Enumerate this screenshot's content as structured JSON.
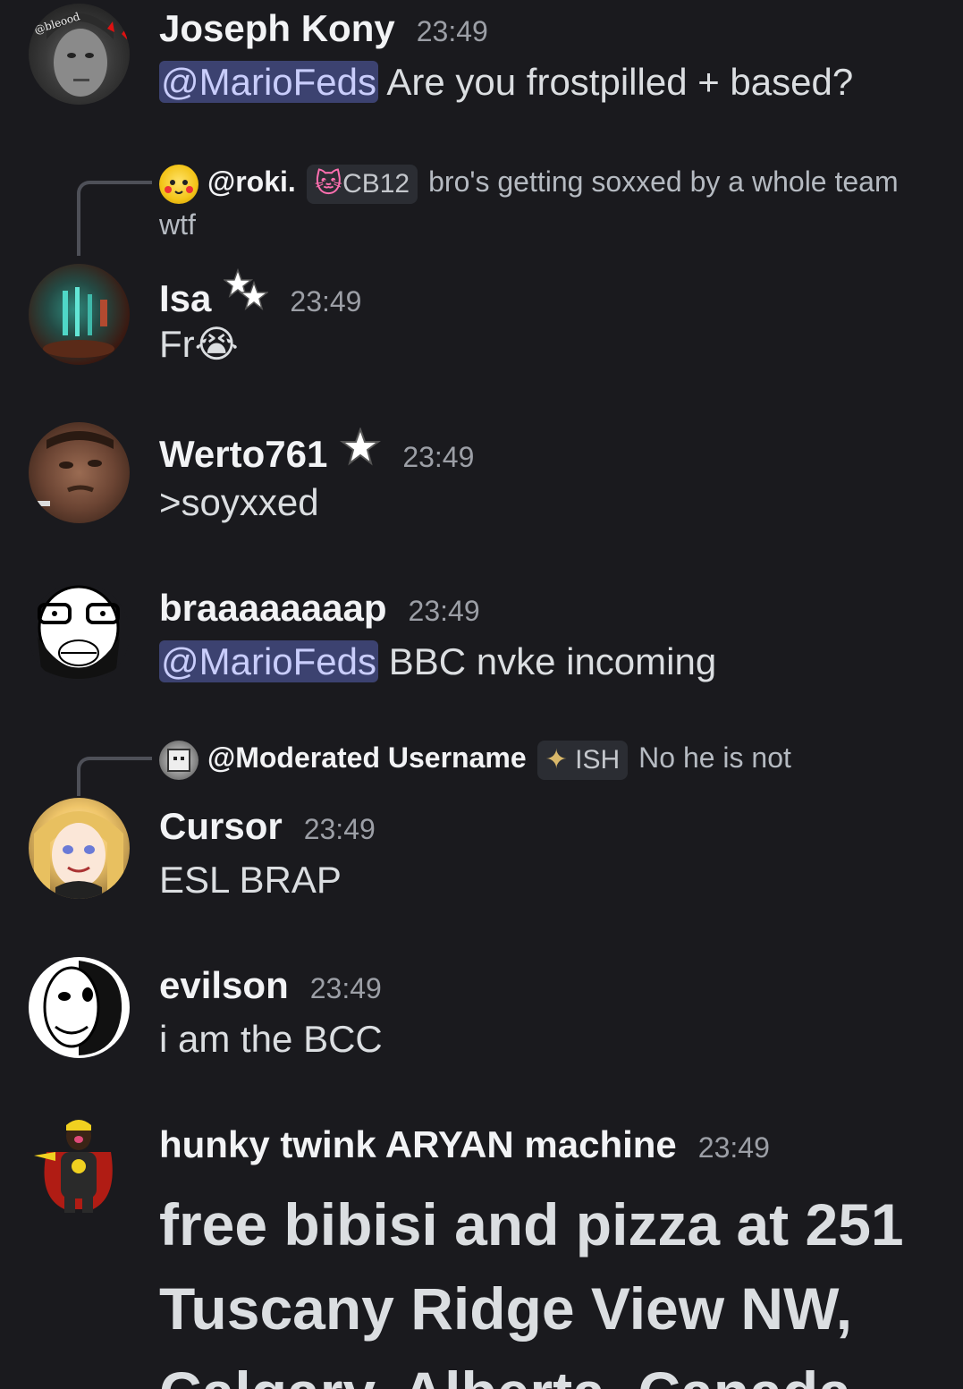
{
  "messages": [
    {
      "user": "Joseph Kony",
      "time": "23:49",
      "mention": "@MarioFeds",
      "text": " Are you frostpilled + based?",
      "avatar_text": "@bleood"
    },
    {
      "reply": {
        "user": "@roki.",
        "tag": "CB12",
        "text": "bro's getting soxxed by a whole team wtf"
      },
      "user": "Isa",
      "time": "23:49",
      "text": "Fr",
      "emoji": "😭"
    },
    {
      "user": "Werto761",
      "time": "23:49",
      "text": ">soyxxed"
    },
    {
      "user": "braaaaaaaap",
      "time": "23:49",
      "mention": "@MarioFeds",
      "text": " BBC nvke incoming"
    },
    {
      "reply": {
        "user": "@Moderated Username",
        "tag": "ISH",
        "text": "No he is not"
      },
      "user": "Cursor",
      "time": "23:49",
      "text": "ESL BRAP"
    },
    {
      "user": "evilson",
      "time": "23:49",
      "text": "i am the BCC"
    },
    {
      "user": "hunky twink ARYAN machine",
      "time": "23:49",
      "text": "free bibisi and pizza at 251 Tuscany Ridge View NW, Calgary, Alberta, Canada"
    }
  ],
  "colors": {
    "background": "#1a1a1e",
    "mention_bg": "#3c4270",
    "mention_fg": "#c9cdfb",
    "username": "#f2f3f5",
    "timestamp": "#9c9fa6"
  }
}
